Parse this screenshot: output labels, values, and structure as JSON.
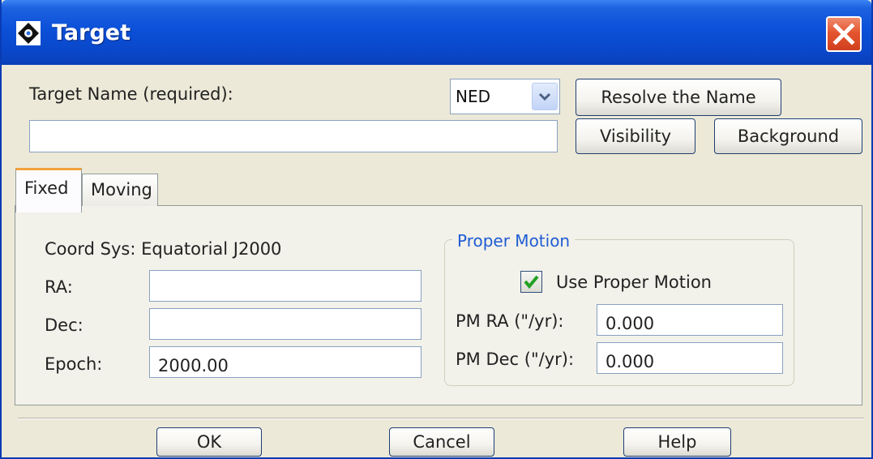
{
  "window": {
    "title": "Target",
    "close_icon": "close-x-icon",
    "app_icon": "diamond-app-icon"
  },
  "target": {
    "name_label": "Target Name (required):",
    "name_value": "",
    "resolver": {
      "selected": "NED"
    },
    "resolve_button": "Resolve the Name",
    "visibility_button": "Visibility",
    "background_button": "Background"
  },
  "tabs": [
    {
      "label": "Fixed",
      "active": true
    },
    {
      "label": "Moving",
      "active": false
    }
  ],
  "fixed": {
    "coord_sys_label": "Coord Sys: Equatorial J2000",
    "ra_label": "RA:",
    "ra_value": "",
    "dec_label": "Dec:",
    "dec_value": "",
    "epoch_label": "Epoch:",
    "epoch_value": "2000.00"
  },
  "proper_motion": {
    "group_title": "Proper Motion",
    "use_label": "Use Proper Motion",
    "use_checked": true,
    "pm_ra_label": "PM RA (\"/yr):",
    "pm_ra_value": "0.000",
    "pm_dec_label": "PM Dec (\"/yr):",
    "pm_dec_value": "0.000"
  },
  "footer": {
    "ok": "OK",
    "cancel": "Cancel",
    "help": "Help"
  },
  "colors": {
    "titlebar": "#0a47c9",
    "close": "#e4552f",
    "group_title": "#1f5cd3",
    "tab_accent": "#f2a23b",
    "check": "#21a121"
  }
}
